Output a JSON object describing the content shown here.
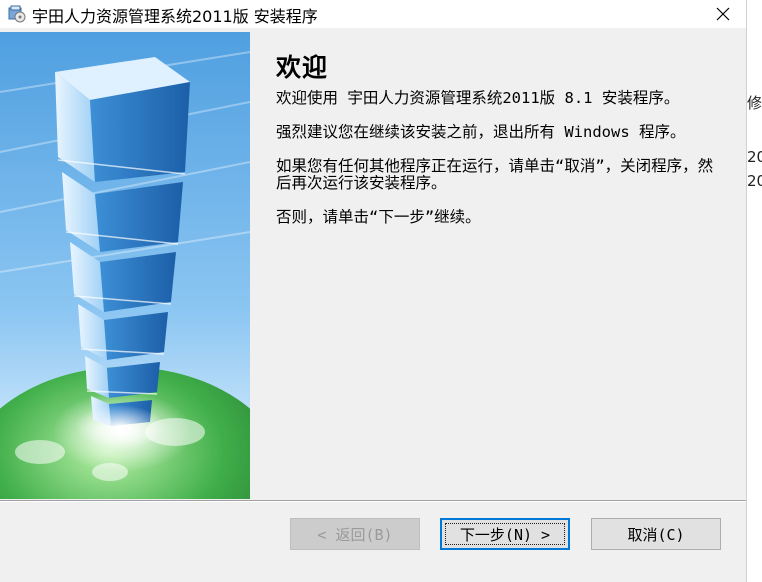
{
  "window": {
    "title": "宇田人力资源管理系统2011版 安装程序"
  },
  "background_window": {
    "fragments": [
      "修改",
      "20",
      "20"
    ]
  },
  "page": {
    "heading": "欢迎",
    "paragraphs": [
      "欢迎使用 宇田人力资源管理系统2011版 8.1 安装程序。",
      "强烈建议您在继续该安装之前，退出所有 Windows 程序。",
      "如果您有任何其他程序正在运行，请单击“取消”，关闭程序，然后再次运行该安装程序。",
      "否则，请单击“下一步”继续。"
    ]
  },
  "buttons": {
    "back": "< 返回(B)",
    "next": "下一步(N) >",
    "cancel": "取消(C)"
  },
  "icons": {
    "app": "installer-app-icon",
    "close": "close-icon"
  },
  "colors": {
    "dialog_bg": "#f0f0f0",
    "titlebar_bg": "#ffffff",
    "default_button_border": "#0078d7",
    "banner_sky": "#5aa9e6",
    "banner_globe": "#3fae49"
  }
}
